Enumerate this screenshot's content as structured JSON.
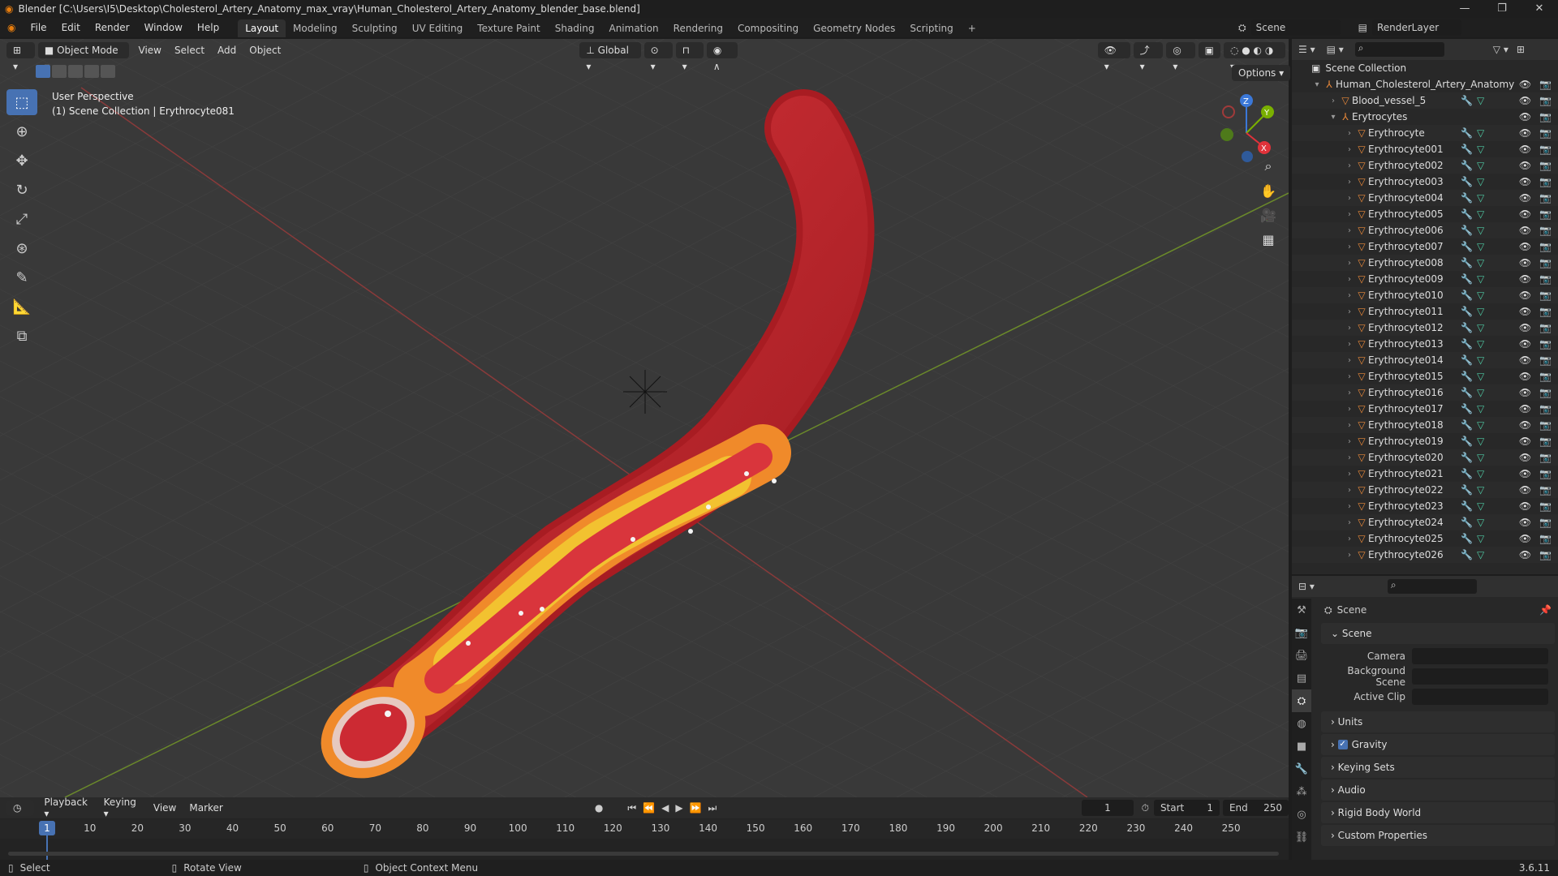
{
  "title_bar": {
    "title": "Blender [C:\\Users\\I5\\Desktop\\Cholesterol_Artery_Anatomy_max_vray\\Human_Cholesterol_Artery_Anatomy_blender_base.blend]",
    "minimize": "—",
    "maximize": "❐",
    "close": "✕"
  },
  "menu": [
    "File",
    "Edit",
    "Render",
    "Window",
    "Help"
  ],
  "workspaces": [
    "Layout",
    "Modeling",
    "Sculpting",
    "UV Editing",
    "Texture Paint",
    "Shading",
    "Animation",
    "Rendering",
    "Compositing",
    "Geometry Nodes",
    "Scripting",
    "+"
  ],
  "scene_selector": {
    "scene": "Scene",
    "render_layer": "RenderLayer"
  },
  "viewport_header": {
    "mode": "Object Mode",
    "menus": [
      "View",
      "Select",
      "Add",
      "Object"
    ],
    "transform_orientation": "Global",
    "options": "Options"
  },
  "viewport": {
    "perspective": "User Perspective",
    "active_object": "(1) Scene Collection | Erythrocyte081",
    "gizmo": {
      "x": "X",
      "y": "Y",
      "z": "Z"
    }
  },
  "outliner": {
    "root": "Scene Collection",
    "items": [
      {
        "label": "Human_Cholesterol_Artery_Anatomy",
        "level": 1,
        "type": "empty"
      },
      {
        "label": "Blood_vessel_5",
        "level": 2,
        "type": "mesh"
      },
      {
        "label": "Erytrocytes",
        "level": 2,
        "type": "empty"
      },
      {
        "label": "Erythrocyte",
        "level": 3,
        "type": "mesh"
      },
      {
        "label": "Erythrocyte001",
        "level": 3,
        "type": "mesh"
      },
      {
        "label": "Erythrocyte002",
        "level": 3,
        "type": "mesh"
      },
      {
        "label": "Erythrocyte003",
        "level": 3,
        "type": "mesh"
      },
      {
        "label": "Erythrocyte004",
        "level": 3,
        "type": "mesh"
      },
      {
        "label": "Erythrocyte005",
        "level": 3,
        "type": "mesh"
      },
      {
        "label": "Erythrocyte006",
        "level": 3,
        "type": "mesh"
      },
      {
        "label": "Erythrocyte007",
        "level": 3,
        "type": "mesh"
      },
      {
        "label": "Erythrocyte008",
        "level": 3,
        "type": "mesh"
      },
      {
        "label": "Erythrocyte009",
        "level": 3,
        "type": "mesh"
      },
      {
        "label": "Erythrocyte010",
        "level": 3,
        "type": "mesh"
      },
      {
        "label": "Erythrocyte011",
        "level": 3,
        "type": "mesh"
      },
      {
        "label": "Erythrocyte012",
        "level": 3,
        "type": "mesh"
      },
      {
        "label": "Erythrocyte013",
        "level": 3,
        "type": "mesh"
      },
      {
        "label": "Erythrocyte014",
        "level": 3,
        "type": "mesh"
      },
      {
        "label": "Erythrocyte015",
        "level": 3,
        "type": "mesh"
      },
      {
        "label": "Erythrocyte016",
        "level": 3,
        "type": "mesh"
      },
      {
        "label": "Erythrocyte017",
        "level": 3,
        "type": "mesh"
      },
      {
        "label": "Erythrocyte018",
        "level": 3,
        "type": "mesh"
      },
      {
        "label": "Erythrocyte019",
        "level": 3,
        "type": "mesh"
      },
      {
        "label": "Erythrocyte020",
        "level": 3,
        "type": "mesh"
      },
      {
        "label": "Erythrocyte021",
        "level": 3,
        "type": "mesh"
      },
      {
        "label": "Erythrocyte022",
        "level": 3,
        "type": "mesh"
      },
      {
        "label": "Erythrocyte023",
        "level": 3,
        "type": "mesh"
      },
      {
        "label": "Erythrocyte024",
        "level": 3,
        "type": "mesh"
      },
      {
        "label": "Erythrocyte025",
        "level": 3,
        "type": "mesh"
      },
      {
        "label": "Erythrocyte026",
        "level": 3,
        "type": "mesh"
      }
    ]
  },
  "properties": {
    "context": "Scene",
    "panel_scene": "Scene",
    "fields": [
      {
        "label": "Camera",
        "value": ""
      },
      {
        "label": "Background Scene",
        "value": ""
      },
      {
        "label": "Active Clip",
        "value": ""
      }
    ],
    "panels": [
      "Units",
      "Gravity",
      "Keying Sets",
      "Audio",
      "Rigid Body World",
      "Custom Properties"
    ]
  },
  "timeline": {
    "menus": [
      "Playback",
      "Keying",
      "View",
      "Marker"
    ],
    "current_frame": "1",
    "start_label": "Start",
    "start": "1",
    "end_label": "End",
    "end": "250",
    "ticks": [
      "1",
      "10",
      "20",
      "30",
      "40",
      "50",
      "60",
      "70",
      "80",
      "90",
      "100",
      "110",
      "120",
      "130",
      "140",
      "150",
      "160",
      "170",
      "180",
      "190",
      "200",
      "210",
      "220",
      "230",
      "240",
      "250"
    ]
  },
  "statusbar": {
    "select": "Select",
    "rotate": "Rotate View",
    "context_menu": "Object Context Menu",
    "version": "3.6.11"
  },
  "colors": {
    "accent": "#4772b3",
    "artery": "#c8262c",
    "plaque": "#f2c230",
    "x_axis": "#8a3a3a",
    "y_axis": "#6b8a2a"
  }
}
